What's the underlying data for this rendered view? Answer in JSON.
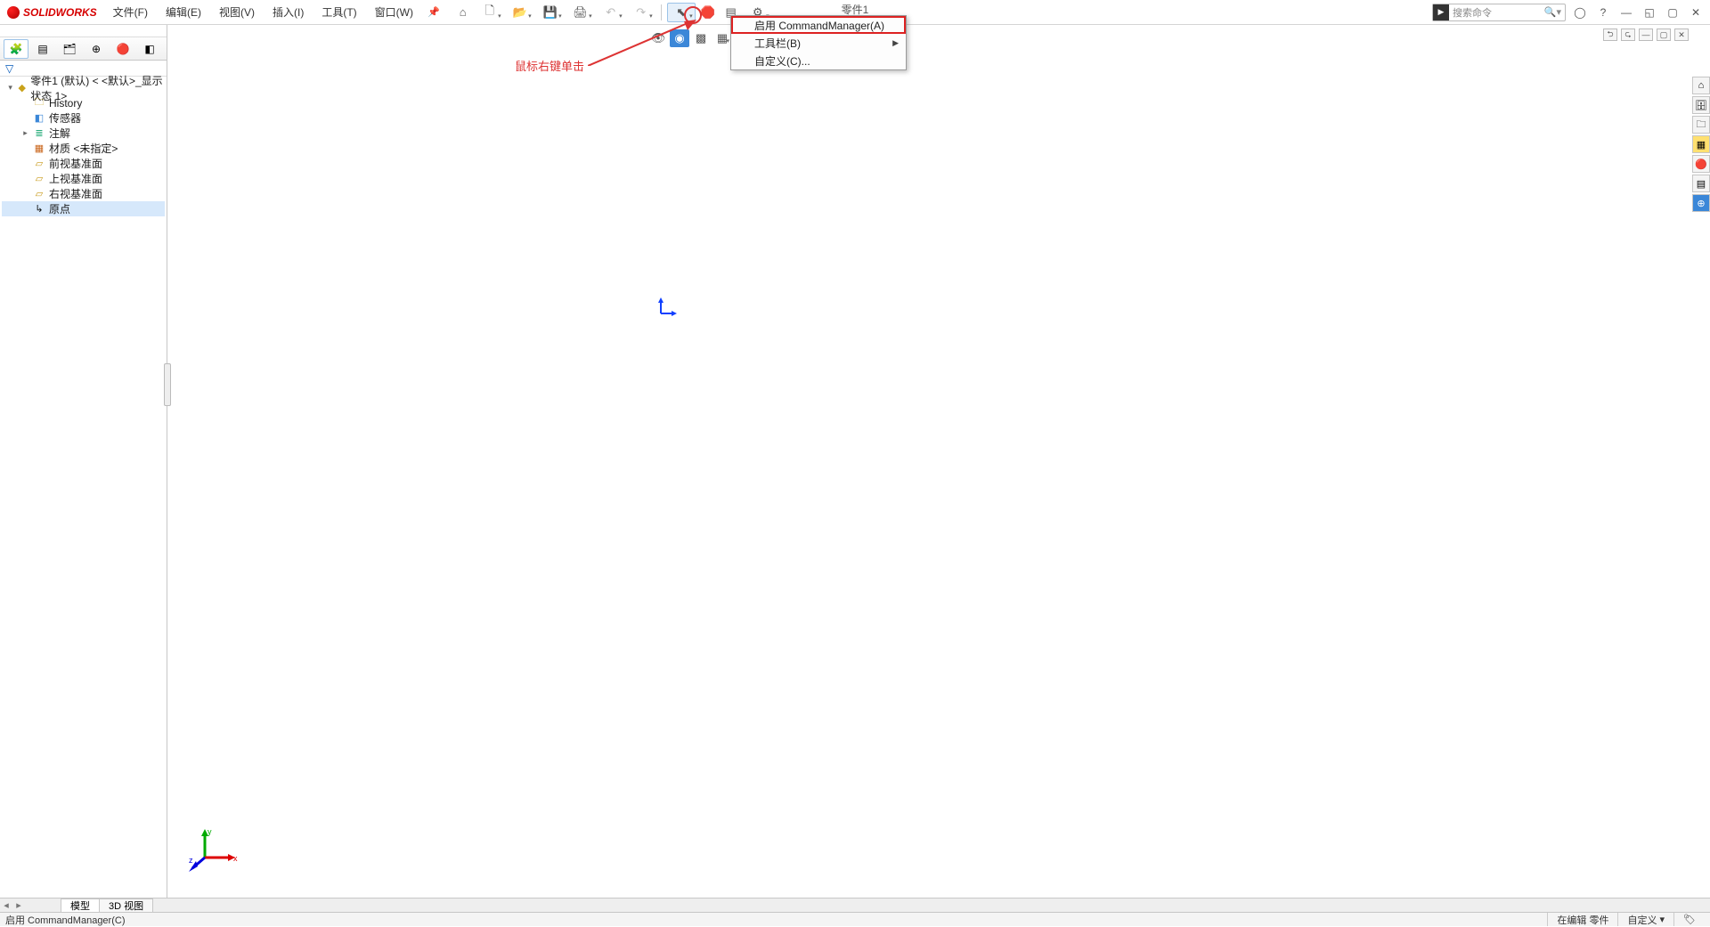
{
  "app": {
    "brand": "SOLIDWORKS",
    "docTitle": "零件1"
  },
  "menu": {
    "file": "文件(F)",
    "edit": "编辑(E)",
    "view": "视图(V)",
    "insert": "插入(I)",
    "tools": "工具(T)",
    "window": "窗口(W)"
  },
  "toolbar": {
    "home": "⌂",
    "new": "🗋",
    "open": "📂",
    "save": "💾",
    "print": "🖨",
    "undo": "↶",
    "redo": "↷",
    "select": "⬉",
    "rebuild": "⟳",
    "options": "⚙"
  },
  "search": {
    "placeholder": "搜索命令"
  },
  "contextMenu": {
    "enableCM": "启用 CommandManager(A)",
    "toolbars": "工具栏(B)",
    "customize": "自定义(C)..."
  },
  "annotation": {
    "text": "鼠标右键单击"
  },
  "tree": {
    "root": "零件1 (默认) < <默认>_显示状态 1>",
    "history": "History",
    "sensors": "传感器",
    "anno": "注解",
    "material": "材质 <未指定>",
    "front": "前视基准面",
    "top": "上视基准面",
    "right": "右视基准面",
    "origin": "原点"
  },
  "triad": {
    "x": "x",
    "y": "y",
    "z": "z"
  },
  "bottomTabs": {
    "model": "模型",
    "view3d": "3D 视图"
  },
  "status": {
    "hint": "启用 CommandManager(C)",
    "editing": "在编辑 零件",
    "custom": "自定义"
  }
}
